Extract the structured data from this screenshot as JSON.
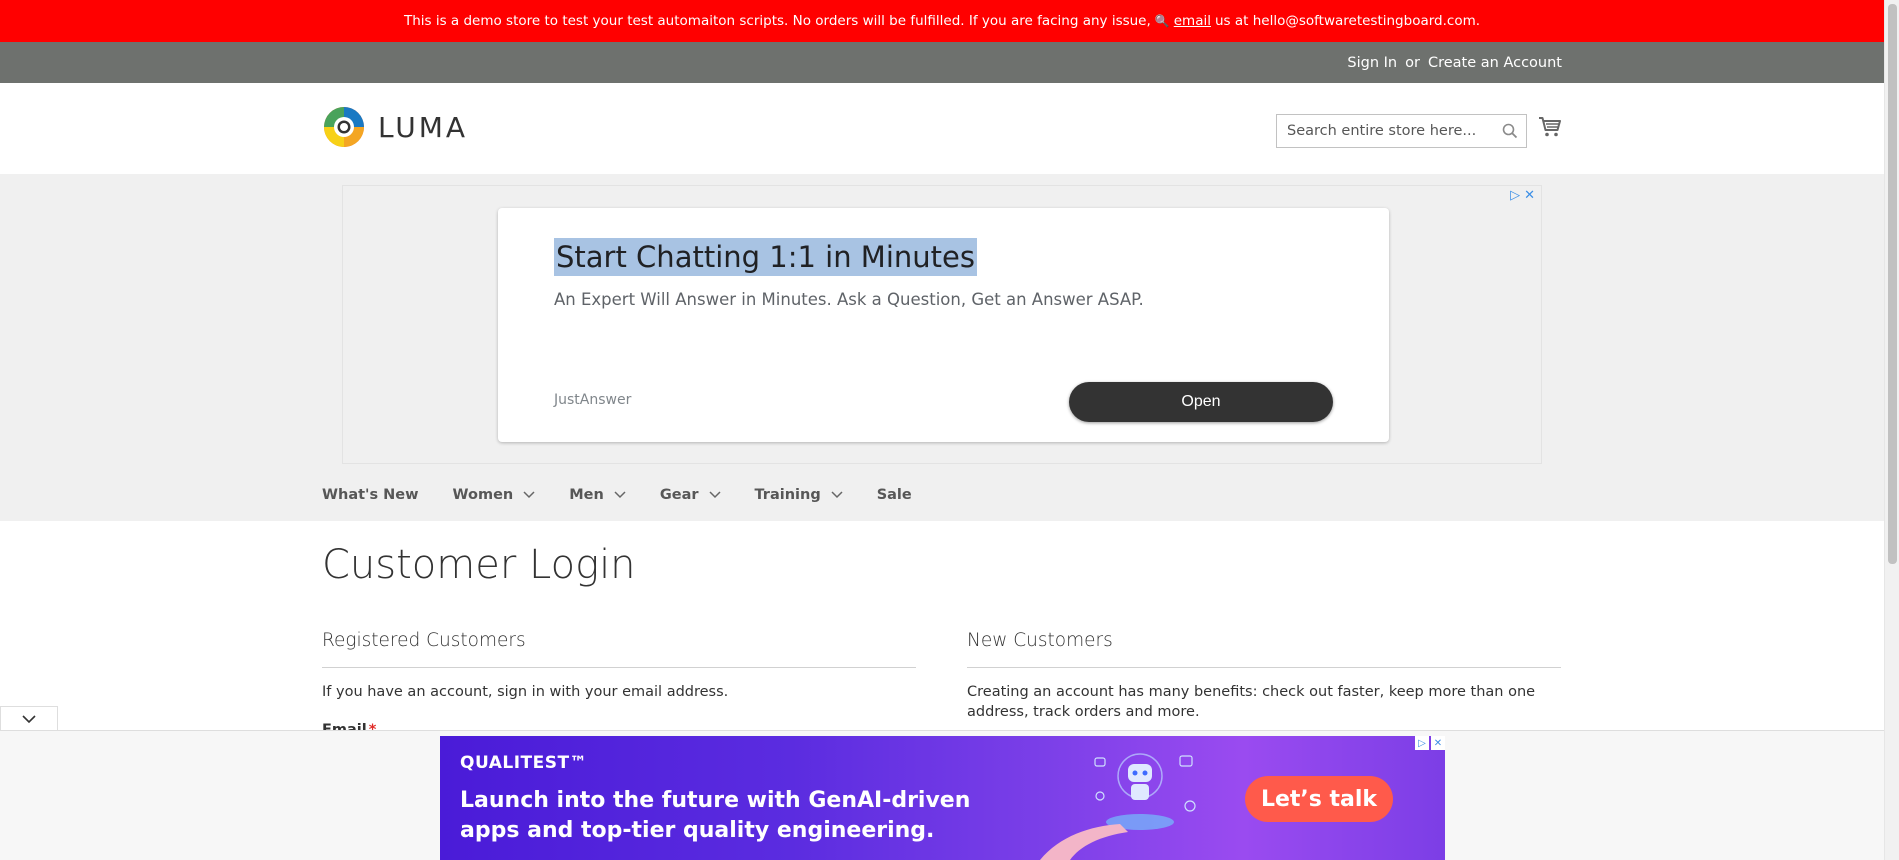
{
  "demo_notice": {
    "text_before": "This is a demo store to test your test automaiton scripts. No orders will be fulfilled. If you are facing any issue,",
    "link": "email",
    "text_after": "us at hello@softwaretestingboard.com."
  },
  "account": {
    "sign_in": "Sign In",
    "or": "or",
    "create_account": "Create an Account"
  },
  "header": {
    "logo_text": "LUMA",
    "search_placeholder": "Search entire store here..."
  },
  "top_ad": {
    "title": "Start Chatting 1:1 in Minutes",
    "description": "An Expert Will Answer in Minutes. Ask a Question, Get an Answer ASAP.",
    "advertiser": "JustAnswer",
    "button": "Open"
  },
  "nav": {
    "items": [
      {
        "label": "What's New",
        "dropdown": false
      },
      {
        "label": "Women",
        "dropdown": true
      },
      {
        "label": "Men",
        "dropdown": true
      },
      {
        "label": "Gear",
        "dropdown": true
      },
      {
        "label": "Training",
        "dropdown": true
      },
      {
        "label": "Sale",
        "dropdown": false
      }
    ]
  },
  "main": {
    "page_title": "Customer Login",
    "registered": {
      "title": "Registered Customers",
      "text": "If you have an account, sign in with your email address.",
      "email_label": "Email",
      "required_mark": "*"
    },
    "new_customers": {
      "title": "New Customers",
      "text": "Creating an account has many benefits: check out faster, keep more than one address, track orders and more."
    }
  },
  "bottom_ad": {
    "brand": "QUALITEST™",
    "headline": "Launch into the future with GenAI-driven apps and top-tier quality engineering.",
    "cta": "Let’s talk"
  },
  "colors": {
    "demo_bar": "#ff0000",
    "account_bar": "#6e716e",
    "nav_bg": "#f0f0f0",
    "cta": "#ff5a4b"
  }
}
